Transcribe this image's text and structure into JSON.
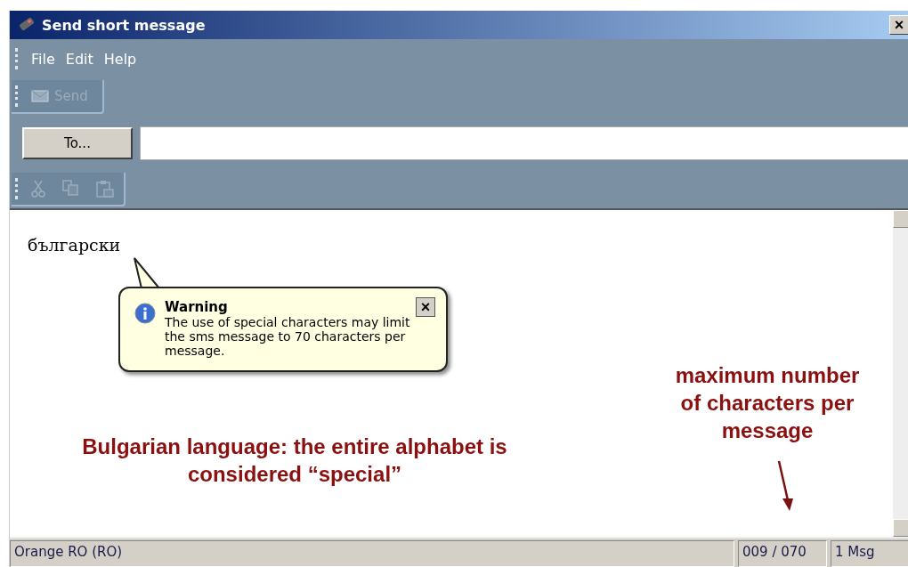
{
  "window": {
    "title": "Send short message",
    "close": "×"
  },
  "menu": [
    "File",
    "Edit",
    "Help"
  ],
  "toolbar": {
    "send": {
      "label": "Send",
      "disabled": true
    }
  },
  "recipient": {
    "button": "To..."
  },
  "message": {
    "text": "български"
  },
  "balloon": {
    "title": "Warning",
    "text": "The use of special characters may limit the sms message to 70 characters per message.",
    "close": "×"
  },
  "annotations": [
    {
      "kind": "note",
      "text": "maximum number of characters per message"
    },
    {
      "kind": "note",
      "text": "Bulgarian language: the entire alphabet is considered “special”"
    }
  ],
  "status_bar": {
    "network": "Orange RO (RO)",
    "count": "009 / 070",
    "messages": "1 Msg"
  }
}
